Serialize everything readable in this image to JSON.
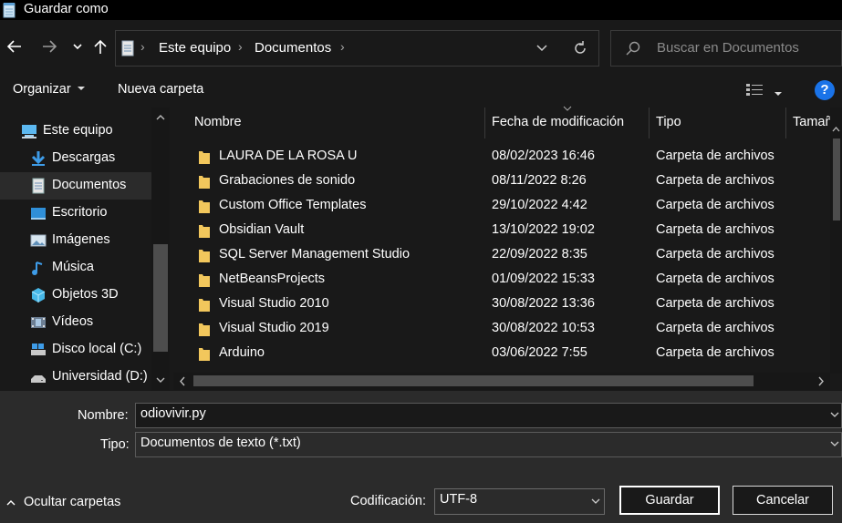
{
  "window": {
    "title": "Guardar como"
  },
  "nav": {
    "back_icon": "arrow-left-icon",
    "forward_icon": "arrow-right-icon",
    "recent_icon": "chevron-down-icon",
    "up_icon": "arrow-up-icon"
  },
  "address": {
    "crumbs": [
      "Este equipo",
      "Documentos"
    ],
    "refresh_icon": "refresh-icon"
  },
  "search": {
    "placeholder": "Buscar en Documentos"
  },
  "commands": {
    "organize": "Organizar",
    "new_folder": "Nueva carpeta",
    "help": "?"
  },
  "sidebar": {
    "items": [
      {
        "label": "Este equipo",
        "icon": "computer-icon"
      },
      {
        "label": "Descargas",
        "icon": "download-icon"
      },
      {
        "label": "Documentos",
        "icon": "document-icon",
        "selected": true
      },
      {
        "label": "Escritorio",
        "icon": "desktop-icon"
      },
      {
        "label": "Imágenes",
        "icon": "pictures-icon"
      },
      {
        "label": "Música",
        "icon": "music-icon"
      },
      {
        "label": "Objetos 3D",
        "icon": "cube-icon"
      },
      {
        "label": "Vídeos",
        "icon": "video-icon"
      },
      {
        "label": "Disco local (C:)",
        "icon": "drive-icon"
      },
      {
        "label": "Universidad (D:)",
        "icon": "drive-icon"
      }
    ]
  },
  "table": {
    "columns": [
      "Nombre",
      "Fecha de modificación",
      "Tipo",
      "Tamaño"
    ],
    "rows": [
      {
        "name": "LAURA DE LA ROSA U",
        "date": "08/02/2023 16:46",
        "type": "Carpeta de archivos"
      },
      {
        "name": "Grabaciones de sonido",
        "date": "08/11/2022 8:26",
        "type": "Carpeta de archivos"
      },
      {
        "name": "Custom Office Templates",
        "date": "29/10/2022 4:42",
        "type": "Carpeta de archivos"
      },
      {
        "name": "Obsidian Vault",
        "date": "13/10/2022 19:02",
        "type": "Carpeta de archivos"
      },
      {
        "name": "SQL Server Management Studio",
        "date": "22/09/2022 8:35",
        "type": "Carpeta de archivos"
      },
      {
        "name": "NetBeansProjects",
        "date": "01/09/2022 15:33",
        "type": "Carpeta de archivos"
      },
      {
        "name": "Visual Studio 2010",
        "date": "30/08/2022 13:36",
        "type": "Carpeta de archivos"
      },
      {
        "name": "Visual Studio 2019",
        "date": "30/08/2022 10:53",
        "type": "Carpeta de archivos"
      },
      {
        "name": "Arduino",
        "date": "03/06/2022 7:55",
        "type": "Carpeta de archivos"
      }
    ]
  },
  "form": {
    "filename_label": "Nombre:",
    "filename_value": "odiovivir.py",
    "type_label": "Tipo:",
    "type_value": "Documentos de texto (*.txt)",
    "encoding_label": "Codificación:",
    "encoding_value": "UTF-8",
    "hide_folders": "Ocultar carpetas",
    "save": "Guardar",
    "cancel": "Cancelar"
  },
  "colors": {
    "folder": "#f2c75c",
    "accent": "#1a73e8",
    "background": "#191919",
    "footer": "#2b2b2b"
  }
}
